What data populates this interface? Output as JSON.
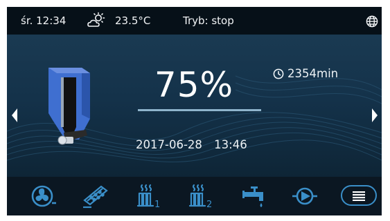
{
  "status": {
    "day_time": "śr. 12:34",
    "temperature": "23.5°C",
    "mode": "Tryb: stop"
  },
  "main": {
    "percent": "75%",
    "date": "2017-06-28",
    "time": "13:46",
    "timer": "2354min"
  },
  "icons": {
    "weather": "partly-cloudy-icon",
    "globe": "globe-icon",
    "clock": "clock-icon",
    "prev": "arrow-left-icon",
    "next": "arrow-right-icon",
    "bottom": [
      "fan-icon",
      "fuel-feeder-icon",
      "heater-1-icon",
      "heater-2-icon",
      "tap-icon",
      "pump-icon",
      "menu-icon"
    ]
  },
  "colors": {
    "accent": "#3a8fc9",
    "hopper": "#3f6fd0"
  }
}
